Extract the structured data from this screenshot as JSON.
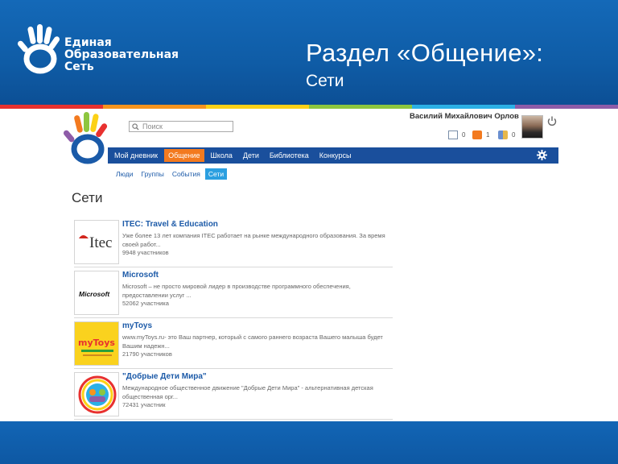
{
  "slide": {
    "brand_lines": [
      "Единая",
      "Образовательная",
      "Сеть"
    ],
    "title": "Раздел «Общение»:",
    "subtitle": "Сети",
    "colors": {
      "header_blue": "#1469b8",
      "footer_blue": "#1265b5",
      "stripe": [
        "#e8312f",
        "#f7941d",
        "#fcd116",
        "#8dc63f",
        "#2bb0e6",
        "#8e5ca8"
      ]
    }
  },
  "app": {
    "search": {
      "placeholder": "Поиск"
    },
    "user": {
      "name": "Василий Михайлович Орлов"
    },
    "stats": [
      {
        "icon": "mail-icon",
        "value": "0"
      },
      {
        "icon": "notification-icon",
        "value": "1"
      },
      {
        "icon": "friends-icon",
        "value": "0"
      }
    ],
    "nav": {
      "items": [
        {
          "label": "Мой дневник",
          "active": false
        },
        {
          "label": "Общение",
          "active": true
        },
        {
          "label": "Школа",
          "active": false
        },
        {
          "label": "Дети",
          "active": false
        },
        {
          "label": "Библиотека",
          "active": false
        },
        {
          "label": "Конкурсы",
          "active": false
        }
      ]
    },
    "subnav": {
      "items": [
        {
          "label": "Люди",
          "active": false
        },
        {
          "label": "Группы",
          "active": false
        },
        {
          "label": "События",
          "active": false
        },
        {
          "label": "Сети",
          "active": true
        }
      ]
    },
    "section_title": "Сети",
    "networks": [
      {
        "name": "ITEC: Travel & Education",
        "desc": "Уже более 13 лет компания ITEC работает на рынке международного образования. За время своей работ...",
        "members": "9948 участников",
        "logo_text": "Itec"
      },
      {
        "name": "Microsoft",
        "desc": "Microsoft – не просто мировой лидер в производстве программного обеспечения, предоставлении услуг ...",
        "members": "52062 участника",
        "logo_text": "Microsoft"
      },
      {
        "name": "myToys",
        "desc": "www.myToys.ru- это Ваш партнер, который с самого раннего возраста Вашего малыша будет Вашим надежн...",
        "members": "21790 участников",
        "logo_text": "myToys"
      },
      {
        "name": "\"Добрые Дети Мира\"",
        "desc": "Международное общественное движение \"Добрые Дети Мира\" - альтернативная детская общественная орг...",
        "members": "72431 участник",
        "logo_text": ""
      }
    ]
  }
}
